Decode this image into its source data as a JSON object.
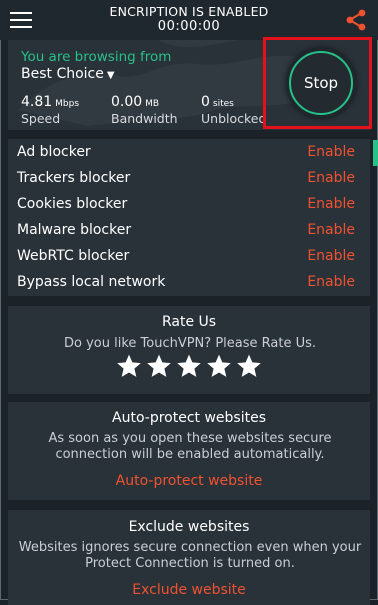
{
  "header": {
    "status_title": "ENCRIPTION IS ENABLED",
    "timer": "00:00:00"
  },
  "browse": {
    "label": "You are browsing from",
    "location": "Best Choice",
    "stats": {
      "speed": {
        "value": "4.81",
        "unit": "Mbps",
        "label": "Speed"
      },
      "bandwidth": {
        "value": "0.00",
        "unit": "MB",
        "label": "Bandwidth"
      },
      "sites": {
        "value": "0",
        "unit": "sites",
        "label": "Unblocked"
      }
    },
    "stop_label": "Stop"
  },
  "blockers": [
    {
      "name": "Ad blocker",
      "action": "Enable"
    },
    {
      "name": "Trackers blocker",
      "action": "Enable"
    },
    {
      "name": "Cookies blocker",
      "action": "Enable"
    },
    {
      "name": "Malware blocker",
      "action": "Enable"
    },
    {
      "name": "WebRTC blocker",
      "action": "Enable"
    },
    {
      "name": "Bypass local network",
      "action": "Enable"
    }
  ],
  "rate": {
    "title": "Rate Us",
    "desc": "Do you like TouchVPN? Please Rate Us.",
    "stars": 5
  },
  "auto_protect": {
    "title": "Auto-protect websites",
    "desc": "As soon as you open these websites secure connection will be enabled automatically.",
    "link": "Auto-protect website"
  },
  "exclude": {
    "title": "Exclude websites",
    "desc": "Websites ignores secure connection even when your Protect Connection is turned on.",
    "link": "Exclude website"
  },
  "colors": {
    "accent_green": "#27c089",
    "action_orange": "#f0522f",
    "highlight_red": "#e4101c",
    "background": "#1b2228",
    "panel": "#2a3239"
  },
  "icons": [
    "menu-icon",
    "share-icon",
    "chevron-down-icon",
    "star-icon"
  ]
}
